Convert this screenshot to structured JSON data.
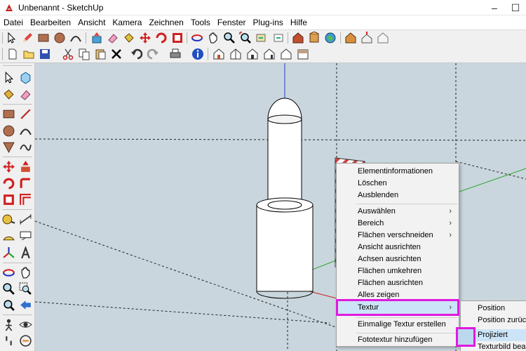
{
  "window": {
    "title": "Unbenannt - SketchUp",
    "minimize_glyph": "–",
    "maximize_glyph": "☐"
  },
  "menubar": {
    "items": [
      "Datei",
      "Bearbeiten",
      "Ansicht",
      "Kamera",
      "Zeichnen",
      "Tools",
      "Fenster",
      "Plug-ins",
      "Hilfe"
    ]
  },
  "context_menu": {
    "items": [
      {
        "label": "Elementinformationen",
        "submenu": false
      },
      {
        "label": "Löschen",
        "submenu": false
      },
      {
        "label": "Ausblenden",
        "submenu": false
      },
      {
        "label": "Auswählen",
        "submenu": true
      },
      {
        "label": "Bereich",
        "submenu": true
      },
      {
        "label": "Flächen verschneiden",
        "submenu": true
      },
      {
        "label": "Ansicht ausrichten",
        "submenu": false
      },
      {
        "label": "Achsen ausrichten",
        "submenu": false
      },
      {
        "label": "Flächen umkehren",
        "submenu": false
      },
      {
        "label": "Flächen ausrichten",
        "submenu": false
      },
      {
        "label": "Alles zeigen",
        "submenu": false
      },
      {
        "label": "Textur",
        "submenu": true,
        "highlighted": true
      },
      {
        "label": "Einmalige Textur erstellen",
        "submenu": false
      },
      {
        "label": "Fototextur hinzufügen",
        "submenu": false
      }
    ],
    "submenu_arrow": "›"
  },
  "texture_submenu": {
    "items": [
      {
        "label": "Position"
      },
      {
        "label": "Position zurücksetzen"
      },
      {
        "label": "Projiziert",
        "highlighted": true
      },
      {
        "label": "Texturbild bearbeiten"
      }
    ]
  },
  "colors": {
    "highlight_outline": "#e01adf",
    "menu_highlight": "#cce4f7",
    "viewport_bg": "#c9d6dd",
    "axis_blue": "#1f3fd0",
    "axis_green": "#2aa52a",
    "axis_red": "#cc2020"
  },
  "toolbar_icons": [
    "select-icon",
    "pencil-icon",
    "rectangle-icon",
    "circle-icon",
    "arc-icon",
    "push-pull-icon",
    "eraser-icon",
    "paint-bucket-icon",
    "move-icon",
    "rotate-icon",
    "scale-icon",
    "orbit-icon",
    "pan-icon",
    "zoom-icon",
    "zoom-extents-icon",
    "previous-view-icon",
    "next-view-icon",
    "warehouse-icon",
    "components-icon",
    "geo-location-icon",
    "extension-warehouse-icon",
    "share-model-icon",
    "layout-icon"
  ],
  "toolbar2_icons": [
    "new-file-icon",
    "open-file-icon",
    "save-icon",
    "cut-icon",
    "copy-icon",
    "paste-icon",
    "delete-icon",
    "undo-icon",
    "redo-icon",
    "print-icon",
    "model-info-icon",
    "iso-view-icon",
    "top-view-icon",
    "front-view-icon",
    "right-view-icon",
    "back-view-icon",
    "left-view-icon"
  ]
}
